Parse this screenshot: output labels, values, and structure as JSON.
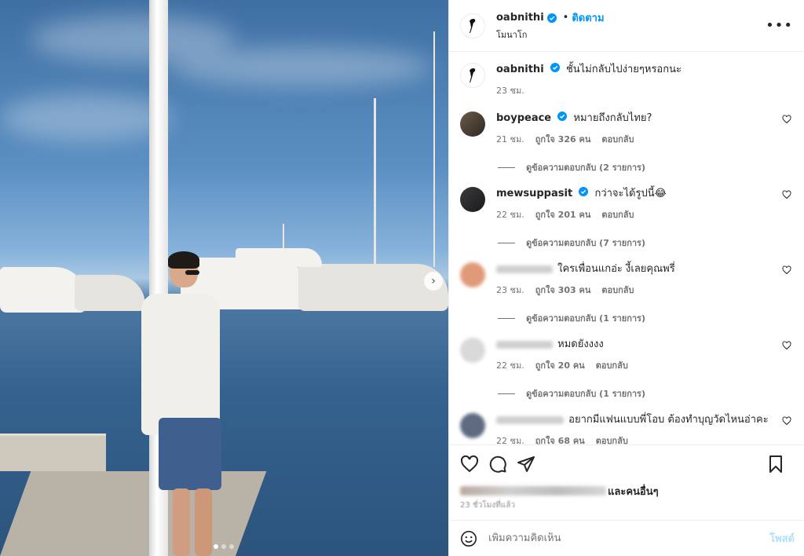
{
  "post": {
    "username": "oabnithi",
    "follow_label": "ติดตาม",
    "location": "โมนาโก",
    "more_label": "•••",
    "caption": "ชั้นไม่กลับไปง่ายๆหรอกนะ",
    "caption_time": "23 ชม."
  },
  "comments": [
    {
      "username": "boypeace",
      "verified": true,
      "text": "หมายถึงกลับไทย?",
      "time": "21 ชม.",
      "likes": "ถูกใจ 326 คน",
      "reply": "ตอบกลับ",
      "view_replies": "ดูข้อความตอบกลับ (2 รายการ)"
    },
    {
      "username": "mewsuppasit",
      "verified": true,
      "text": "กว่าจะได้รูปนี้😂",
      "time": "22 ชม.",
      "likes": "ถูกใจ 201 คน",
      "reply": "ตอบกลับ",
      "view_replies": "ดูข้อความตอบกลับ (7 รายการ)"
    },
    {
      "username": "",
      "verified": false,
      "text": "ใครเพื่อนแกอ่ะ งี้เลยคุณพรี่",
      "time": "23 ชม.",
      "likes": "ถูกใจ 303 คน",
      "reply": "ตอบกลับ",
      "view_replies": "ดูข้อความตอบกลับ (1 รายการ)"
    },
    {
      "username": "",
      "verified": false,
      "text": "หมดยังงงง",
      "time": "22 ชม.",
      "likes": "ถูกใจ 20 คน",
      "reply": "ตอบกลับ",
      "view_replies": "ดูข้อความตอบกลับ (1 รายการ)"
    },
    {
      "username": "",
      "verified": false,
      "text": "อยากมีแฟนแบบพี่โอบ ต้องทำบุญวัดไหนอ่าคะ",
      "time": "22 ชม.",
      "likes": "ถูกใจ 68 คน",
      "reply": "ตอบกลับ"
    }
  ],
  "likes_summary": {
    "others": "และคนอื่นๆ"
  },
  "post_time": "23 ชั่วโมงที่แล้ว",
  "add_comment": {
    "placeholder": "เพิ่มความคิดเห็น",
    "post_label": "โพสต์"
  },
  "media": {
    "next_glyph": "›",
    "slide_count": 3,
    "active_slide": 1
  },
  "icons": [
    "verified-badge-icon",
    "heart-icon",
    "comment-icon",
    "share-icon",
    "bookmark-icon",
    "emoji-icon",
    "more-icon",
    "chevron-right-icon"
  ],
  "colors": {
    "accent": "#0095f6",
    "text": "#262626",
    "muted": "#737373",
    "post_disabled": "#b2dffc"
  }
}
